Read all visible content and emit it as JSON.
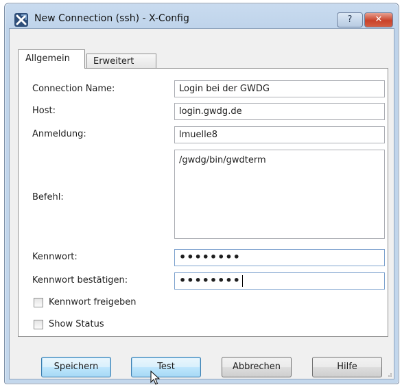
{
  "window": {
    "title": "New Connection (ssh) - X-Config",
    "help_label": "?",
    "close_label": "✕"
  },
  "tabs": [
    {
      "label": "Allgemein",
      "active": true
    },
    {
      "label": "Erweitert",
      "active": false
    }
  ],
  "form": {
    "connection_name": {
      "label": "Connection Name:",
      "value": "Login bei der GWDG"
    },
    "host": {
      "label": "Host:",
      "value": "login.gwdg.de"
    },
    "login": {
      "label": "Anmeldung:",
      "value": "lmuelle8"
    },
    "command": {
      "label": "Befehl:",
      "value": "/gwdg/bin/gwdterm"
    },
    "password": {
      "label": "Kennwort:",
      "value": "••••••••"
    },
    "password_confirm": {
      "label": "Kennwort bestätigen:",
      "value": "••••••••"
    }
  },
  "checkboxes": [
    {
      "label": "Kennwort freigeben",
      "checked": false
    },
    {
      "label": "Show Status",
      "checked": false
    }
  ],
  "buttons": {
    "save": "Speichern",
    "test": "Test",
    "cancel": "Abbrechen",
    "help": "Hilfe"
  },
  "colors": {
    "title_bar": "#c3d7ec",
    "close_button": "#c9422a",
    "default_button": "#bee6fd"
  }
}
